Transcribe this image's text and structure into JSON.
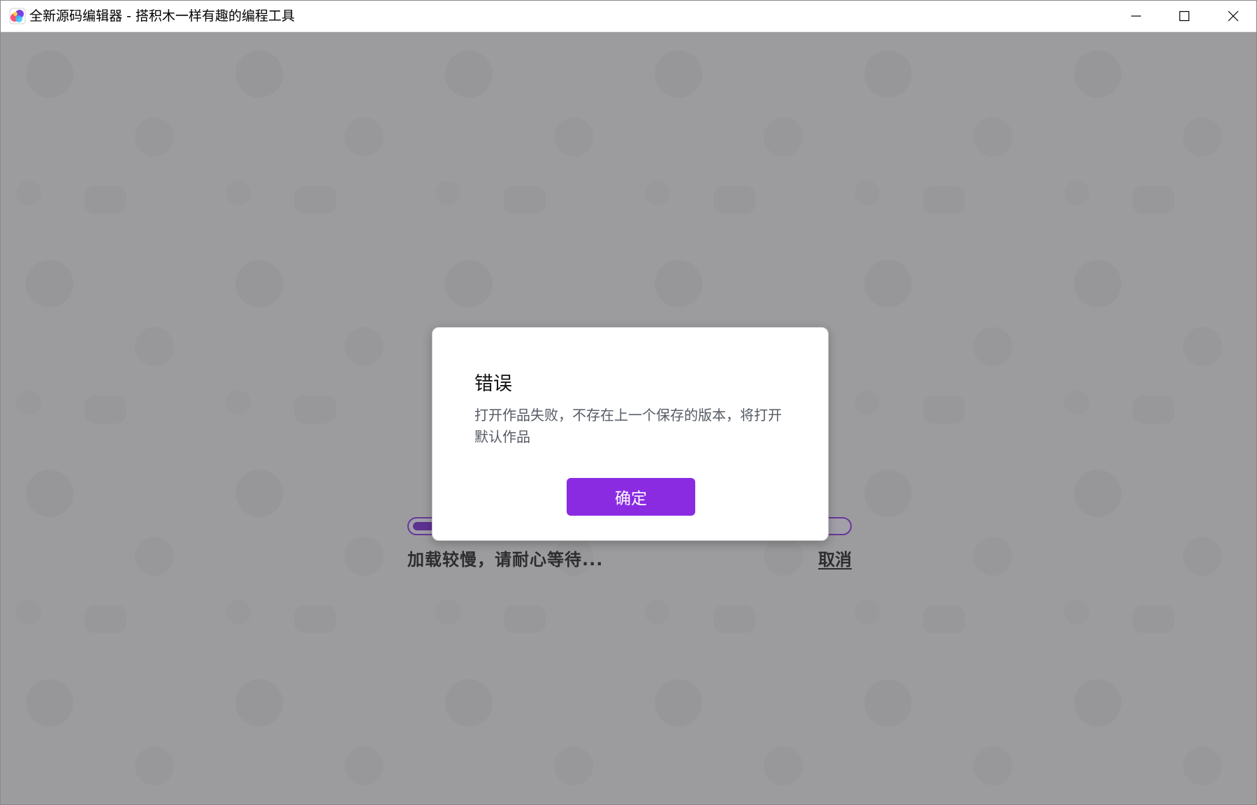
{
  "window": {
    "title": "全新源码编辑器 - 搭积木一样有趣的编程工具",
    "icon": "app-logo-icon",
    "controls": [
      "minimize-icon",
      "maximize-icon",
      "close-icon"
    ]
  },
  "loading": {
    "progress_fraction": 0.05,
    "status_text": "加载较慢，请耐心等待...",
    "cancel_label": "取消"
  },
  "dialog": {
    "title": "错误",
    "message": "打开作品失败，不存在上一个保存的版本，将打开默认作品",
    "confirm_label": "确定"
  },
  "colors": {
    "accent": "#8a2be2",
    "progress_fill": "#7a2bd4",
    "overlay": "#3c3c40"
  }
}
